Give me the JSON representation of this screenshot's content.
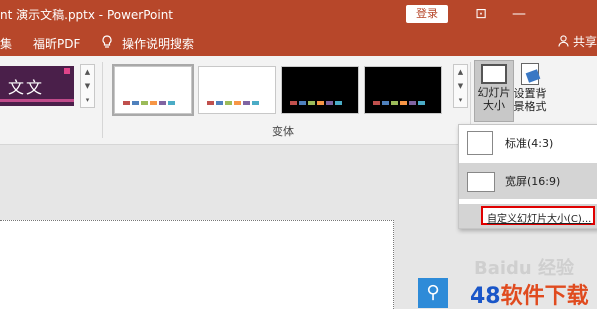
{
  "titlebar": {
    "title": "nt  演示文稿.pptx  -  PowerPoint",
    "login": "登录",
    "restore_glyph": "⊡",
    "minimize_glyph": "—"
  },
  "tabs": {
    "items": [
      {
        "label": "集"
      },
      {
        "label": "福昕PDF"
      },
      {
        "label": "操作说明搜索"
      }
    ],
    "share": "共享",
    "tell_me_icon": "lightbulb-icon",
    "share_icon": "person-icon"
  },
  "ribbon": {
    "theme_text": "文文",
    "variants_group_label": "变体",
    "slide_size_label_line1": "幻灯片",
    "slide_size_label_line2": "大小",
    "format_bg_line1": "设置背",
    "format_bg_line2": "景格式",
    "scroll_up": "▲",
    "scroll_down": "▼",
    "scroll_more": "▾",
    "variant_colors": [
      "#c0504d",
      "#4f81bd",
      "#9bbb59",
      "#f79646",
      "#8064a2",
      "#4bacc6"
    ]
  },
  "dropdown": {
    "standard": "标准(4:3)",
    "widescreen": "宽屏(16:9)",
    "custom": "自定义幻灯片大小(C)..."
  },
  "watermark": {
    "baidu": "Baidu 经验",
    "search_glyph": "⚲",
    "brand_number": "48",
    "brand_text": "软件下载"
  },
  "colors": {
    "accent": "#b7472a",
    "highlight_box": "#e00000"
  }
}
